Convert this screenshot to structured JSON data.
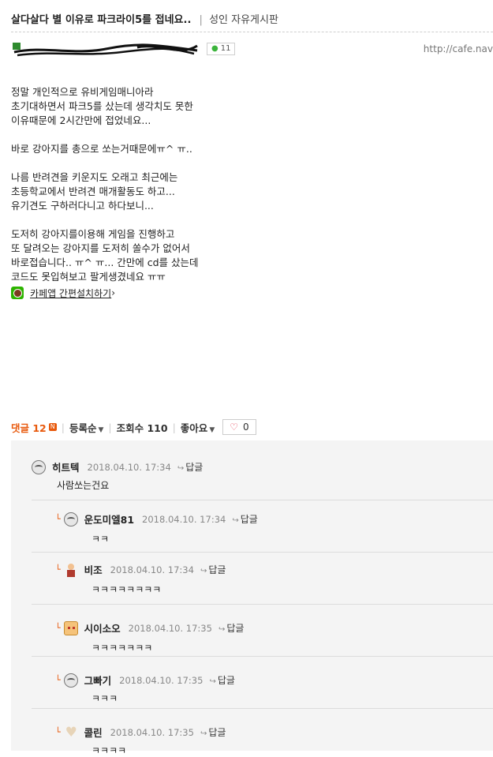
{
  "post": {
    "title": "살다살다 별 이유로 파크라이5를 접네요..",
    "separator": "|",
    "board": "성인 자유게시판",
    "comment_badge": "11",
    "cafe_url": "http://cafe.nav",
    "content_lines": [
      "정말 개인적으로 유비게임매니아라",
      "초기대하면서 파크5를 샀는데 생각치도 못한",
      "이유때문에 2시간만에 접었네요...",
      "",
      "바로 강아지를 총으로 쏘는거때문에ㅠ^ ㅠ..",
      "",
      "나름 반려견을 키운지도 오래고 최근에는",
      "초등학교에서 반려견 매개활동도 하고...",
      "유기견도 구하러다니고 하다보니...",
      "",
      "도저히 강아지를이용해 게임을 진행하고",
      "또 달려오는 강아지를 도저히 쏠수가 없어서",
      "바로접습니다.. ㅠ^ ㅠ... 간만에 cd를 샀는데",
      "코드도 못입혀보고 팔게생겼네요 ㅠㅠ"
    ],
    "cafe_app_link": "카페앱 간편설치하기"
  },
  "stats": {
    "reply_label": "댓글 12",
    "new_badge": "N",
    "sort_label": "등록순",
    "views_label": "조회수 110",
    "like_label": "좋아요",
    "like_count": "0"
  },
  "comments": [
    {
      "nick": "히트텍",
      "date": "2018.04.10. 17:34",
      "reply": "답글",
      "body": "사람쏘는건요",
      "avatar": "grey-avatar",
      "nested": false
    },
    {
      "nick": "운도미엘81",
      "date": "2018.04.10. 17:34",
      "reply": "답글",
      "body": "ㅋㅋ",
      "avatar": "grey-avatar",
      "nested": true
    },
    {
      "nick": "비조",
      "date": "2018.04.10. 17:34",
      "reply": "답글",
      "body": "ㅋㅋㅋㅋㅋㅋㅋㅋ",
      "avatar": "figure-avatar",
      "nested": true
    },
    {
      "nick": "시이소오",
      "date": "2018.04.10. 17:35",
      "reply": "답글",
      "body": "ㅋㅋㅋㅋㅋㅋㅋ",
      "avatar": "box-avatar",
      "nested": true
    },
    {
      "nick": "그빠기",
      "date": "2018.04.10. 17:35",
      "reply": "답글",
      "body": "ㅋㅋㅋ",
      "avatar": "grey-avatar",
      "nested": true
    },
    {
      "nick": "콜린",
      "date": "2018.04.10. 17:35",
      "reply": "답글",
      "body": "ㅋㅋㅋㅋ",
      "avatar": "heart-avatar",
      "nested": true
    }
  ],
  "colors": {
    "accent_orange": "#e8590c",
    "comment_bg": "#f4f4f4",
    "cafe_green": "#2db400"
  }
}
